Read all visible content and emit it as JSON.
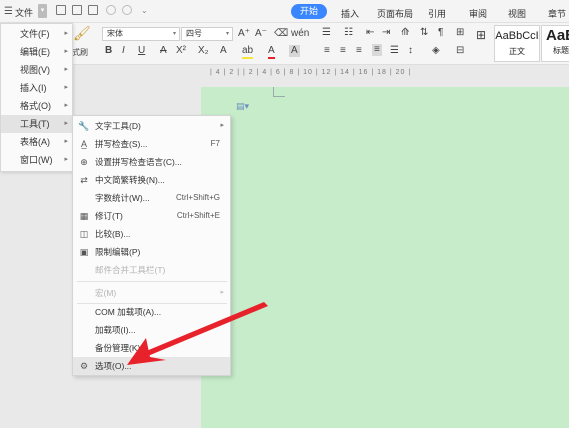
{
  "topbar": {
    "menu_icon": "menu-icon",
    "file_label": "文件",
    "tabs": [
      {
        "label": "开始",
        "active": true
      },
      {
        "label": "插入"
      },
      {
        "label": "页面布局"
      },
      {
        "label": "引用"
      },
      {
        "label": "审阅"
      },
      {
        "label": "视图"
      },
      {
        "label": "章节"
      }
    ]
  },
  "ribbon": {
    "format_painter_label": "式刷",
    "font_name": "宋体",
    "font_size": "四号",
    "bold": "B",
    "italic": "I",
    "underline": "U",
    "strikethrough": "A",
    "superscript": "X²",
    "subscript": "X₂",
    "grow_font": "A⁺",
    "shrink_font": "A⁻",
    "font_color": "A",
    "styles": [
      {
        "sample": "AaBbCcI",
        "caption": "正文"
      },
      {
        "sample": "AaB",
        "caption": "标题"
      }
    ]
  },
  "main_menu": {
    "items": [
      {
        "label": "文件(F)",
        "has_sub": true
      },
      {
        "label": "编辑(E)",
        "has_sub": true
      },
      {
        "label": "视图(V)",
        "has_sub": true
      },
      {
        "label": "插入(I)",
        "has_sub": true
      },
      {
        "label": "格式(O)",
        "has_sub": true
      },
      {
        "label": "工具(T)",
        "has_sub": true,
        "highlighted": true
      },
      {
        "label": "表格(A)",
        "has_sub": true
      },
      {
        "label": "窗口(W)",
        "has_sub": true
      }
    ]
  },
  "tools_menu": {
    "items": [
      {
        "label": "文字工具(D)",
        "icon": "text-tool-icon",
        "has_sub": true
      },
      {
        "label": "拼写检查(S)...",
        "icon": "spellcheck-icon",
        "shortcut": "F7"
      },
      {
        "label": "设置拼写检查语言(C)...",
        "icon": "language-icon"
      },
      {
        "label": "中文简繁转换(N)...",
        "icon": "convert-icon"
      },
      {
        "label": "字数统计(W)...",
        "shortcut": "Ctrl+Shift+G"
      },
      {
        "label": "修订(T)",
        "icon": "revise-icon",
        "shortcut": "Ctrl+Shift+E"
      },
      {
        "label": "比较(B)...",
        "icon": "compare-icon"
      },
      {
        "label": "限制编辑(P)",
        "icon": "restrict-icon"
      },
      {
        "label": "邮件合并工具栏(T)",
        "disabled": true
      },
      {
        "label": "宏(M)",
        "disabled": true,
        "has_sub": true
      },
      {
        "label": "COM 加载项(A)..."
      },
      {
        "label": "加载项(I)..."
      },
      {
        "label": "备份管理(K)..."
      },
      {
        "label": "选项(O)...",
        "icon": "gear-icon",
        "highlighted": true
      }
    ]
  },
  "ruler_marks": "|  4  |  2  |     |  2  |  4  |  6  |  8  |  10  |  12  |  14  |  16  |  18  |  20  |",
  "colors": {
    "accent": "#3a86ff",
    "page": "#c6ecca",
    "arrow": "#e8222a"
  }
}
